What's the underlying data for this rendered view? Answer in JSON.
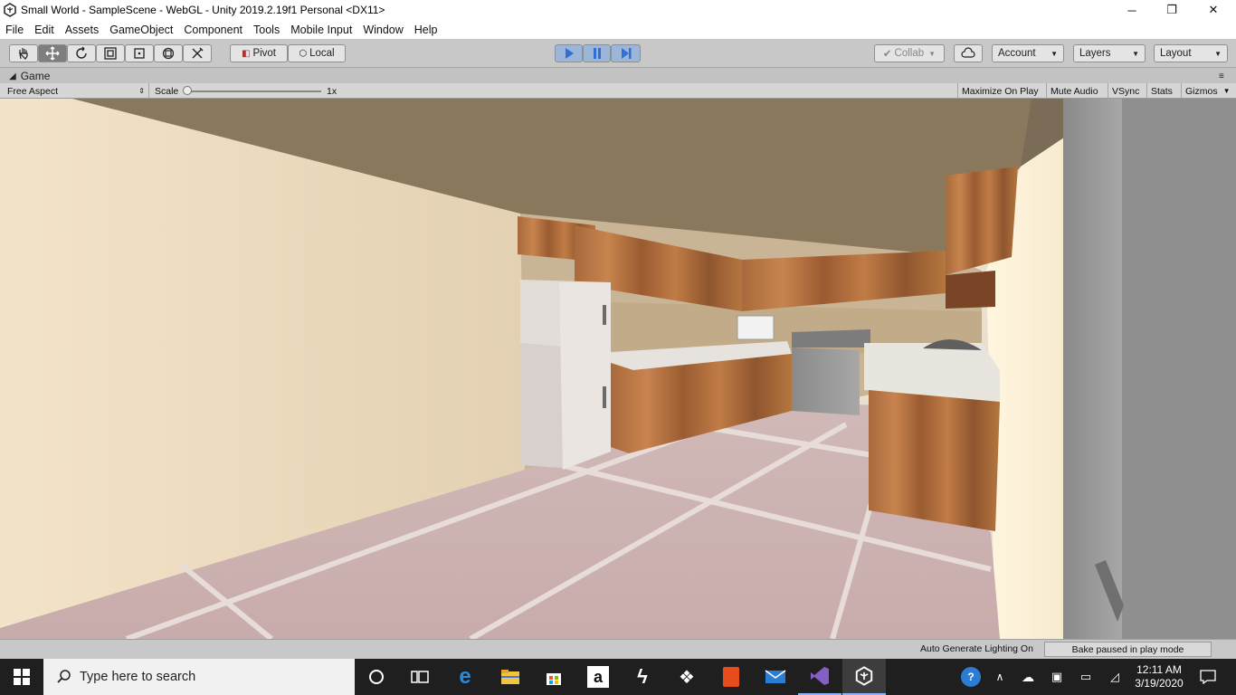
{
  "window": {
    "title": "Small World - SampleScene - WebGL - Unity 2019.2.19f1 Personal <DX11>",
    "minimize": "─",
    "maximize": "❐",
    "close": "✕"
  },
  "menu": [
    "File",
    "Edit",
    "Assets",
    "GameObject",
    "Component",
    "Tools",
    "Mobile Input",
    "Window",
    "Help"
  ],
  "toolbar": {
    "tools": [
      "hand-tool-icon",
      "move-tool-icon",
      "rotate-tool-icon",
      "scale-tool-icon",
      "rect-tool-icon",
      "transform-tool-icon",
      "custom-tool-icon"
    ],
    "pivot_label": "Pivot",
    "local_label": "Local",
    "collab_label": "Collab",
    "account_label": "Account",
    "layers_label": "Layers",
    "layout_label": "Layout",
    "accent_color": "#2f6fd6",
    "play_active": true
  },
  "game_panel": {
    "tab_label": "Game",
    "aspect": "Free Aspect",
    "scale_label": "Scale",
    "scale_value": "1x",
    "maximize_on_play": "Maximize On Play",
    "mute_audio": "Mute Audio",
    "vsync": "VSync",
    "stats": "Stats",
    "gizmos": "Gizmos"
  },
  "status": {
    "auto_lighting": "Auto Generate Lighting On",
    "bake_status": "Bake paused in play mode"
  },
  "taskbar": {
    "search_placeholder": "Type here to search",
    "apps": [
      "cortana-icon",
      "task-view-icon",
      "edge-icon",
      "file-explorer-icon",
      "store-icon",
      "amazon-icon",
      "ultrasharp-icon",
      "dropbox-icon",
      "office-icon",
      "mail-icon",
      "visual-studio-icon",
      "unity-icon"
    ],
    "time": "12:11 AM",
    "date": "3/19/2020"
  }
}
